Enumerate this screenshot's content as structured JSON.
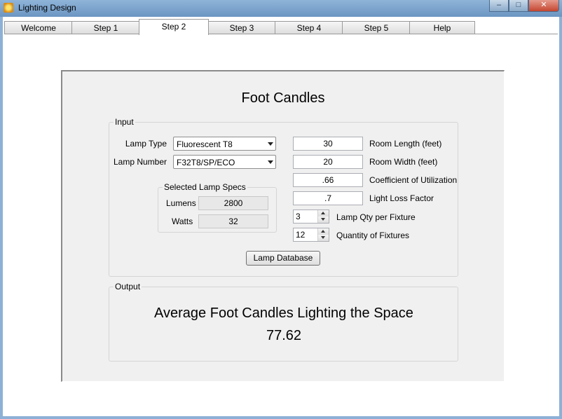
{
  "window": {
    "title": "Lighting Design",
    "minimize_glyph": "–",
    "maximize_glyph": "□",
    "close_glyph": "✕"
  },
  "tabs": [
    {
      "label": "Welcome"
    },
    {
      "label": "Step 1"
    },
    {
      "label": "Step 2",
      "active": true
    },
    {
      "label": "Step 3"
    },
    {
      "label": "Step 4"
    },
    {
      "label": "Step 5"
    },
    {
      "label": "Help"
    }
  ],
  "main": {
    "heading": "Foot Candles",
    "input": {
      "group_label": "Input",
      "lamp_type_label": "Lamp Type",
      "lamp_type_value": "Fluorescent T8",
      "lamp_number_label": "Lamp Number",
      "lamp_number_value": "F32T8/SP/ECO",
      "specs": {
        "group_label": "Selected Lamp Specs",
        "lumens_label": "Lumens",
        "lumens_value": "2800",
        "watts_label": "Watts",
        "watts_value": "32"
      },
      "room_length_value": "30",
      "room_length_label": "Room Length (feet)",
      "room_width_value": "20",
      "room_width_label": "Room Width (feet)",
      "cu_value": ".66",
      "cu_label": "Coefficient of Utilization",
      "llf_value": ".7",
      "llf_label": "Light Loss Factor",
      "lamp_qty_value": "3",
      "lamp_qty_label": "Lamp Qty per Fixture",
      "fixture_qty_value": "12",
      "fixture_qty_label": "Quantity of Fixtures",
      "lamp_database_button": "Lamp Database"
    },
    "output": {
      "group_label": "Output",
      "title": "Average Foot Candles Lighting the Space",
      "value": "77.62"
    }
  }
}
